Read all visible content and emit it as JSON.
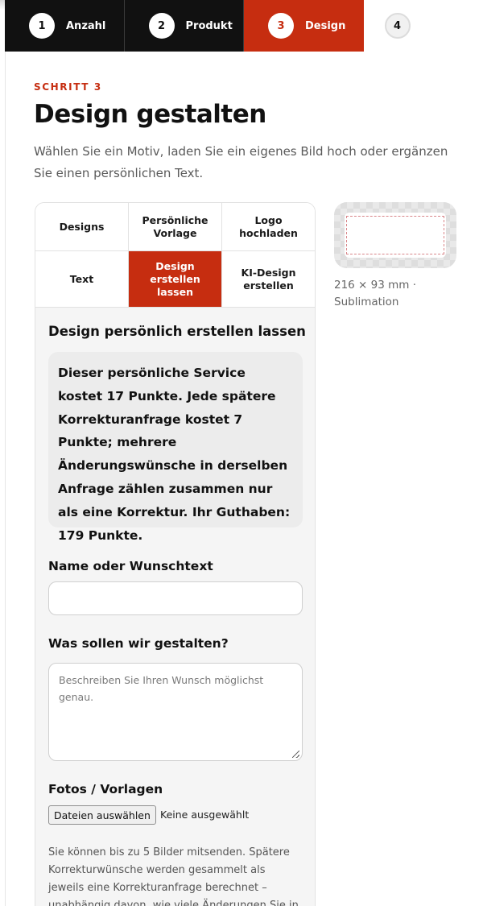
{
  "stepper": {
    "steps": [
      {
        "number": "1",
        "label": "Anzahl",
        "state": "done"
      },
      {
        "number": "2",
        "label": "Produkt",
        "state": "done"
      },
      {
        "number": "3",
        "label": "Design",
        "state": "active"
      },
      {
        "number": "4",
        "label": "",
        "state": "upcoming"
      }
    ]
  },
  "header": {
    "eyebrow": "SCHRITT 3",
    "title": "Design gestalten",
    "subtitle": "Wählen Sie ein Motiv, laden Sie ein eigenes Bild hoch oder ergänzen Sie einen persönlichen Text."
  },
  "tabs": [
    {
      "label": "Designs",
      "active": false
    },
    {
      "label": "Persönliche Vorlage",
      "active": false
    },
    {
      "label": "Logo hochladen",
      "active": false
    },
    {
      "label": "Text",
      "active": false
    },
    {
      "label": "Design erstellen lassen",
      "active": true
    },
    {
      "label": "KI-Design erstellen",
      "active": false
    }
  ],
  "panel": {
    "heading": "Design persönlich erstellen lassen",
    "info": "Dieser persönliche Service kostet 17 Punkte. Jede spätere Korrekturanfrage kostet 7 Punkte; mehrere Änderungswünsche in derselben Anfrage zählen zusammen nur als eine Korrektur. Ihr Guthaben: 179 Punkte.",
    "name_label": "Name oder Wunschtext",
    "name_value": "",
    "wish_label": "Was sollen wir gestalten?",
    "wish_placeholder": "Beschreiben Sie Ihren Wunsch möglichst genau.",
    "photos_label": "Fotos / Vorlagen",
    "file_button": "Dateien auswählen",
    "file_status": "Keine ausgewählt",
    "note": "Sie können bis zu 5 Bilder mitsenden. Spätere Korrekturwünsche werden gesammelt als jeweils eine Korrekturanfrage berechnet – unabhängig davon, wie viele Änderungen Sie in"
  },
  "preview": {
    "caption": "216 × 93 mm · Sublimation"
  },
  "colors": {
    "accent": "#c62d10",
    "step_bg": "#111111"
  }
}
